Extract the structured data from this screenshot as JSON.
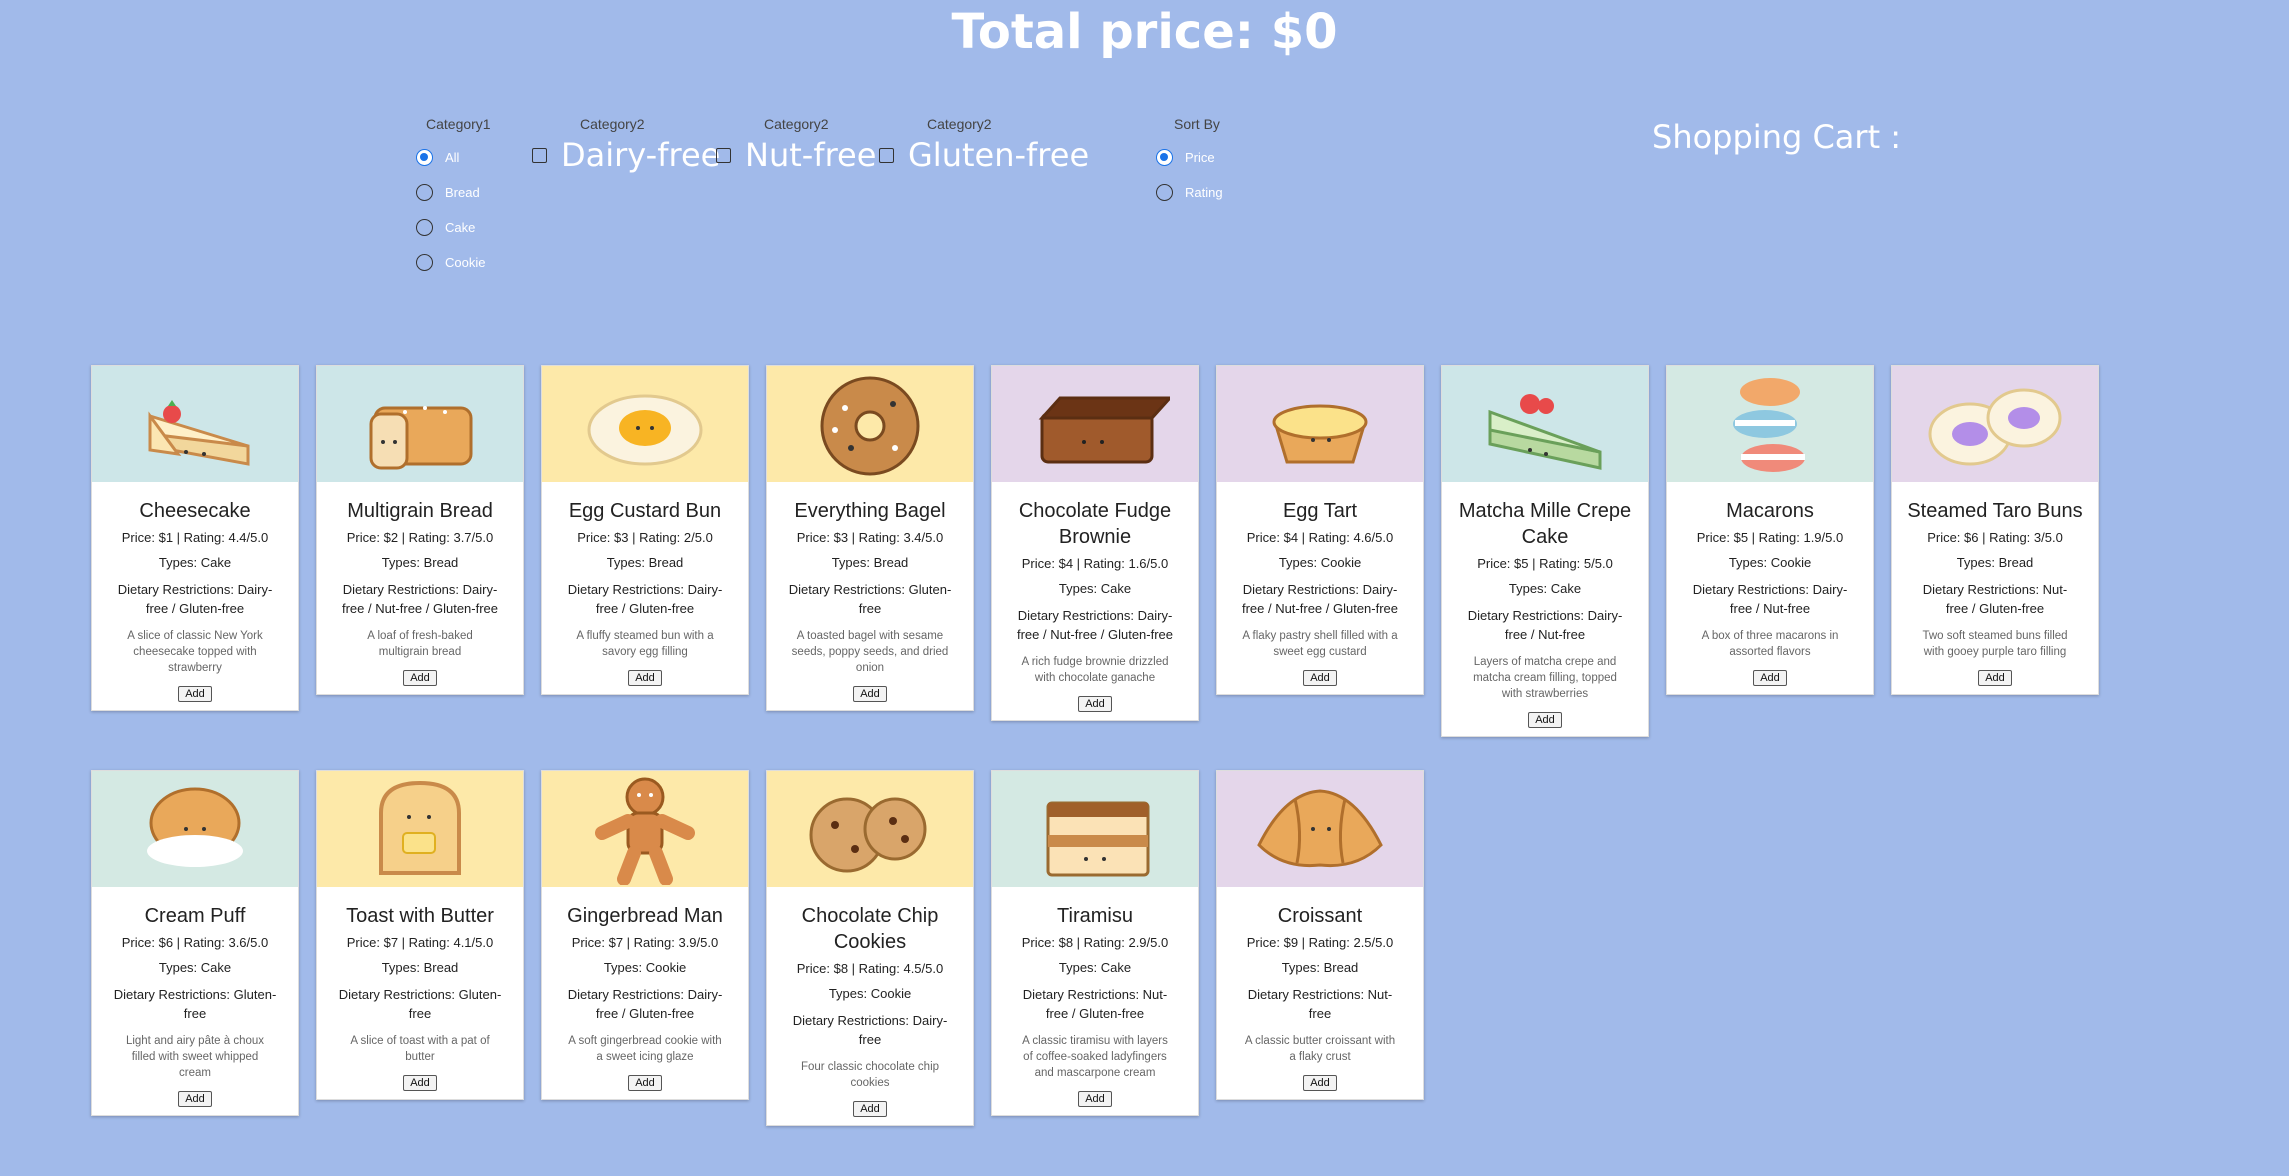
{
  "total_price": "Total price: $0",
  "filters": {
    "category1": {
      "title": "Category1",
      "options": [
        {
          "label": "All",
          "selected": true
        },
        {
          "label": "Bread",
          "selected": false
        },
        {
          "label": "Cake",
          "selected": false
        },
        {
          "label": "Cookie",
          "selected": false
        }
      ]
    },
    "category2": [
      {
        "title": "Category2",
        "label": "Dairy-free",
        "checked": false
      },
      {
        "title": "Category2",
        "label": "Nut-free",
        "checked": false
      },
      {
        "title": "Category2",
        "label": "Gluten-free",
        "checked": false
      }
    ],
    "sort_by": {
      "title": "Sort By",
      "options": [
        {
          "label": "Price",
          "selected": true
        },
        {
          "label": "Rating",
          "selected": false
        }
      ]
    }
  },
  "cart": {
    "title": "Shopping Cart :"
  },
  "colors": {
    "background": "#a1baea",
    "teal": "#cde6e8",
    "yellow": "#fde9a9",
    "lavender": "#e4d6ea",
    "mint": "#d4e9e3",
    "radio_accent": "#1a73e8"
  },
  "items": [
    {
      "name": "Cheesecake",
      "price": "Price: $1 | Rating: 4.4/5.0",
      "types": "Types: Cake",
      "diet": "Dietary Restrictions: Dairy-free / Gluten-free",
      "desc": "A slice of classic New York cheesecake topped with strawberry",
      "button": "Add",
      "bg": "teal",
      "icon": "cheesecake-icon"
    },
    {
      "name": "Multigrain Bread",
      "price": "Price: $2 | Rating: 3.7/5.0",
      "types": "Types: Bread",
      "diet": "Dietary Restrictions: Dairy-free / Nut-free / Gluten-free",
      "desc": "A loaf of fresh-baked multigrain bread",
      "button": "Add",
      "bg": "teal",
      "icon": "bread-loaf-icon"
    },
    {
      "name": "Egg Custard Bun",
      "price": "Price: $3 | Rating: 2/5.0",
      "types": "Types: Bread",
      "diet": "Dietary Restrictions: Dairy-free / Gluten-free",
      "desc": "A fluffy steamed bun with a savory egg filling",
      "button": "Add",
      "bg": "yellow",
      "icon": "custard-bun-icon"
    },
    {
      "name": "Everything Bagel",
      "price": "Price: $3 | Rating: 3.4/5.0",
      "types": "Types: Bread",
      "diet": "Dietary Restrictions: Gluten-free",
      "desc": "A toasted bagel with sesame seeds, poppy seeds, and dried onion",
      "button": "Add",
      "bg": "yellow",
      "icon": "bagel-icon"
    },
    {
      "name": "Chocolate Fudge Brownie",
      "price": "Price: $4 | Rating: 1.6/5.0",
      "types": "Types: Cake",
      "diet": "Dietary Restrictions: Dairy-free / Nut-free / Gluten-free",
      "desc": "A rich fudge brownie drizzled with chocolate ganache",
      "button": "Add",
      "bg": "lavender",
      "icon": "brownie-icon"
    },
    {
      "name": "Egg Tart",
      "price": "Price: $4 | Rating: 4.6/5.0",
      "types": "Types: Cookie",
      "diet": "Dietary Restrictions: Dairy-free / Nut-free / Gluten-free",
      "desc": "A flaky pastry shell filled with a sweet egg custard",
      "button": "Add",
      "bg": "lavender",
      "icon": "egg-tart-icon"
    },
    {
      "name": "Matcha Mille Crepe Cake",
      "price": "Price: $5 | Rating: 5/5.0",
      "types": "Types: Cake",
      "diet": "Dietary Restrictions: Dairy-free / Nut-free",
      "desc": "Layers of matcha crepe and matcha cream filling, topped with strawberries",
      "button": "Add",
      "bg": "teal",
      "icon": "matcha-cake-icon"
    },
    {
      "name": "Macarons",
      "price": "Price: $5 | Rating: 1.9/5.0",
      "types": "Types: Cookie",
      "diet": "Dietary Restrictions: Dairy-free / Nut-free",
      "desc": "A box of three macarons in assorted flavors",
      "button": "Add",
      "bg": "mint",
      "icon": "macarons-icon"
    },
    {
      "name": "Steamed Taro Buns",
      "price": "Price: $6 | Rating: 3/5.0",
      "types": "Types: Bread",
      "diet": "Dietary Restrictions: Nut-free / Gluten-free",
      "desc": "Two soft steamed buns filled with gooey purple taro filling",
      "button": "Add",
      "bg": "lavender",
      "icon": "taro-buns-icon"
    },
    {
      "name": "Cream Puff",
      "price": "Price: $6 | Rating: 3.6/5.0",
      "types": "Types: Cake",
      "diet": "Dietary Restrictions: Gluten-free",
      "desc": "Light and airy pâte à choux filled with sweet whipped cream",
      "button": "Add",
      "bg": "mint",
      "icon": "cream-puff-icon"
    },
    {
      "name": "Toast with Butter",
      "price": "Price: $7 | Rating: 4.1/5.0",
      "types": "Types: Bread",
      "diet": "Dietary Restrictions: Gluten-free",
      "desc": "A slice of toast with a pat of butter",
      "button": "Add",
      "bg": "yellow",
      "icon": "toast-icon"
    },
    {
      "name": "Gingerbread Man",
      "price": "Price: $7 | Rating: 3.9/5.0",
      "types": "Types: Cookie",
      "diet": "Dietary Restrictions: Dairy-free / Gluten-free",
      "desc": "A soft gingerbread cookie with a sweet icing glaze",
      "button": "Add",
      "bg": "yellow",
      "icon": "gingerbread-icon"
    },
    {
      "name": "Chocolate Chip Cookies",
      "price": "Price: $8 | Rating: 4.5/5.0",
      "types": "Types: Cookie",
      "diet": "Dietary Restrictions: Dairy-free",
      "desc": "Four classic chocolate chip cookies",
      "button": "Add",
      "bg": "yellow",
      "icon": "cookies-icon"
    },
    {
      "name": "Tiramisu",
      "price": "Price: $8 | Rating: 2.9/5.0",
      "types": "Types: Cake",
      "diet": "Dietary Restrictions: Nut-free / Gluten-free",
      "desc": "A classic tiramisu with layers of coffee-soaked ladyfingers and mascarpone cream",
      "button": "Add",
      "bg": "mint",
      "icon": "tiramisu-icon"
    },
    {
      "name": "Croissant",
      "price": "Price: $9 | Rating: 2.5/5.0",
      "types": "Types: Bread",
      "diet": "Dietary Restrictions: Nut-free",
      "desc": "A classic butter croissant with a flaky crust",
      "button": "Add",
      "bg": "lavender",
      "icon": "croissant-icon"
    }
  ]
}
